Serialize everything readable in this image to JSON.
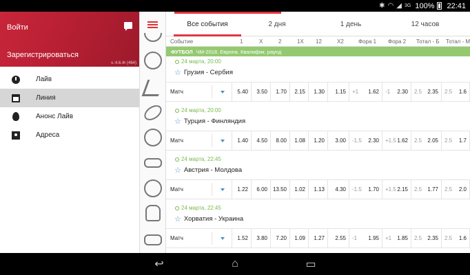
{
  "status": {
    "network": "3G",
    "battery": "100%",
    "clock": "22:41"
  },
  "drawer": {
    "login": "Войти",
    "register": "Зарегистрироваться",
    "version": "v.:4.6.4r (464)",
    "menu": [
      {
        "label": "Лайв",
        "icon": "clock-icon"
      },
      {
        "label": "Линия",
        "icon": "calendar-icon",
        "active": true
      },
      {
        "label": "Анонс Лайв",
        "icon": "fire-icon"
      },
      {
        "label": "Адреса",
        "icon": "map-marker-icon"
      }
    ]
  },
  "tabs": [
    "Все события",
    "2 дня",
    "1 день",
    "12 часов"
  ],
  "columns": [
    "Событие",
    "1",
    "X",
    "2",
    "1X",
    "12",
    "X2",
    "Фора 1",
    "Фора 2",
    "Тотал - Б",
    "Тотал - М"
  ],
  "league": {
    "sport": "ФУТБОЛ",
    "name": "ЧМ-2018. Европа. Квалифик. раунд"
  },
  "events": [
    {
      "time": "24 марта, 20:00",
      "teams": "Грузия - Сербия",
      "market": "Матч",
      "odds": [
        "5.40",
        "3.50",
        "1.70",
        "2.15",
        "1.30",
        "1.15"
      ],
      "fora1": {
        "h": "+1",
        "v": "1.62"
      },
      "fora2": {
        "h": "-1",
        "v": "2.30"
      },
      "tb": {
        "h": "2.5",
        "v": "2.35"
      },
      "tm": {
        "h": "2.5",
        "v": "1.6"
      }
    },
    {
      "time": "24 марта, 20:00",
      "teams": "Турция - Финляндия",
      "market": "Матч",
      "odds": [
        "1.40",
        "4.50",
        "8.00",
        "1.08",
        "1.20",
        "3.00"
      ],
      "fora1": {
        "h": "-1.5",
        "v": "2.30"
      },
      "fora2": {
        "h": "+1.5",
        "v": "1.62"
      },
      "tb": {
        "h": "2.5",
        "v": "2.05"
      },
      "tm": {
        "h": "2.5",
        "v": "1.7"
      }
    },
    {
      "time": "24 марта, 22:45",
      "teams": "Австрия - Молдова",
      "market": "Матч",
      "odds": [
        "1.22",
        "6.00",
        "13.50",
        "1.02",
        "1.13",
        "4.30"
      ],
      "fora1": {
        "h": "-1.5",
        "v": "1.70"
      },
      "fora2": {
        "h": "+1.5",
        "v": "2.15"
      },
      "tb": {
        "h": "2.5",
        "v": "1.77"
      },
      "tm": {
        "h": "2.5",
        "v": "2.0"
      }
    },
    {
      "time": "24 марта, 22:45",
      "teams": "Хорватия - Украина",
      "market": "Матч",
      "odds": [
        "1.52",
        "3.80",
        "7.20",
        "1.09",
        "1.27",
        "2.55"
      ],
      "fora1": {
        "h": "-1",
        "v": "1.95"
      },
      "fora2": {
        "h": "+1",
        "v": "1.85"
      },
      "tb": {
        "h": "2.5",
        "v": "2.35"
      },
      "tm": {
        "h": "2.5",
        "v": "1.6"
      }
    }
  ],
  "colors": {
    "brand": "#c8263a",
    "accent": "#e4343f",
    "league_bar": "#94c970",
    "star": "#4a90c4"
  }
}
